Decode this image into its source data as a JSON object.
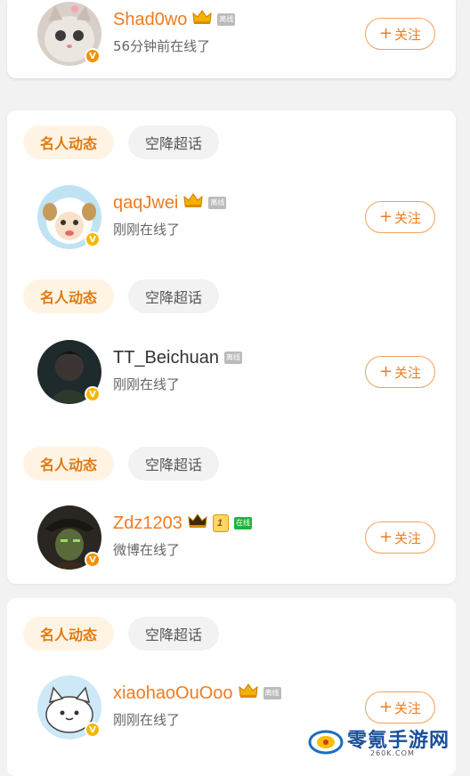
{
  "feed": {
    "pill_active": "名人动态",
    "pill_inactive": "空降超话",
    "follow_plus": "+",
    "follow_label": "关注",
    "offline_tag": "离线",
    "online_tag": "在线",
    "users": [
      {
        "name": "Shad0wo",
        "status": "56分钟前在线了",
        "tag": "离线",
        "verified": "V"
      },
      {
        "name": "qaqJwei",
        "status": "刚刚在线了",
        "tag": "离线",
        "verified": "V"
      },
      {
        "name": "TT_Beichuan",
        "status": "刚刚在线了",
        "tag": "离线",
        "verified": "V"
      },
      {
        "name": "Zdz1203",
        "status": "微博在线了",
        "tag": "在线",
        "level": "1",
        "verified": "V"
      },
      {
        "name": "xiaohaoOuOoo",
        "status": "刚刚在线了",
        "tag": "离线",
        "verified": "V"
      }
    ]
  },
  "watermark": {
    "title": "零氪手游网",
    "subtitle": "260K.COM"
  },
  "colors": {
    "accent": "#f27b1f",
    "badge_orange": "#f29100",
    "badge_yellow": "#f5b800",
    "online_green": "#1fb43d"
  }
}
